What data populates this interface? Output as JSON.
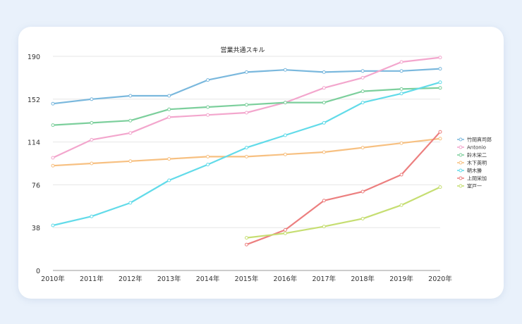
{
  "chart_data": {
    "type": "line",
    "title": "営業共通スキル",
    "categories": [
      "2010年",
      "2011年",
      "2012年",
      "2013年",
      "2014年",
      "2015年",
      "2016年",
      "2017年",
      "2018年",
      "2019年",
      "2020年"
    ],
    "ylim": [
      0,
      190
    ],
    "yticks": [
      0,
      38,
      76,
      114,
      152,
      190
    ],
    "grid": true,
    "legend_position": "right",
    "series": [
      {
        "name": "竹岡真司郎",
        "color": "#7ab8dd",
        "values": [
          148,
          152,
          155,
          155,
          169,
          176,
          178,
          176,
          177,
          177,
          179
        ]
      },
      {
        "name": "Antonio",
        "color": "#f3a6cd",
        "values": [
          100,
          116,
          122,
          136,
          138,
          140,
          149,
          162,
          171,
          185,
          189
        ]
      },
      {
        "name": "鈴木栄二",
        "color": "#7ccf9c",
        "values": [
          129,
          131,
          133,
          143,
          145,
          147,
          149,
          149,
          159,
          161,
          162
        ]
      },
      {
        "name": "木下英明",
        "color": "#f7c081",
        "values": [
          93,
          95,
          97,
          99,
          101,
          101,
          103,
          105,
          109,
          113,
          117
        ]
      },
      {
        "name": "朝木勝",
        "color": "#62dbe9",
        "values": [
          40,
          48,
          60,
          80,
          94,
          109,
          120,
          131,
          149,
          157,
          167
        ]
      },
      {
        "name": "上岡栄加",
        "color": "#ec7f7f",
        "values": [
          null,
          null,
          null,
          null,
          null,
          23,
          36,
          62,
          70,
          85,
          123
        ]
      },
      {
        "name": "室戸一",
        "color": "#c6de72",
        "values": [
          null,
          null,
          null,
          null,
          null,
          29,
          33,
          39,
          46,
          58,
          74
        ]
      }
    ]
  }
}
